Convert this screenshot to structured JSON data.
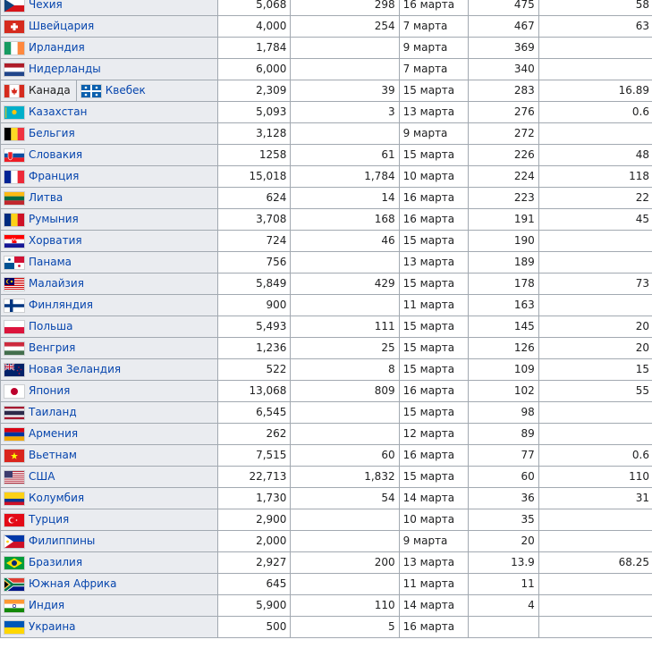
{
  "rows": [
    {
      "country": "Чехия",
      "flag": "flag-czech",
      "a": "5,068",
      "b": "298",
      "date": "16 марта",
      "d": "475",
      "e": "58"
    },
    {
      "country": "Швейцария",
      "flag": "flag-switzerland",
      "a": "4,000",
      "b": "254",
      "date": "7 марта",
      "d": "467",
      "e": "63"
    },
    {
      "country": "Ирландия",
      "flag": "flag-ireland",
      "a": "1,784",
      "b": "",
      "date": "9 марта",
      "d": "369",
      "e": ""
    },
    {
      "country": "Нидерланды",
      "flag": "flag-netherlands",
      "a": "6,000",
      "b": "",
      "date": "7 марта",
      "d": "340",
      "e": ""
    },
    {
      "country": "Канада",
      "flag": "flag-canada",
      "sub": "Квебек",
      "subflag": "flag-quebec",
      "a": "2,309",
      "b": "39",
      "date": "15 марта",
      "d": "283",
      "e": "16.89"
    },
    {
      "country": "Казахстан",
      "flag": "flag-kazakhstan",
      "a": "5,093",
      "b": "3",
      "date": "13 марта",
      "d": "276",
      "e": "0.6"
    },
    {
      "country": "Бельгия",
      "flag": "flag-belgium",
      "a": "3,128",
      "b": "",
      "date": "9 марта",
      "d": "272",
      "e": ""
    },
    {
      "country": "Словакия",
      "flag": "flag-slovakia",
      "a": "1258",
      "b": "61",
      "date": "15 марта",
      "d": "226",
      "e": "48"
    },
    {
      "country": "Франция",
      "flag": "flag-france",
      "a": "15,018",
      "b": "1,784",
      "date": "10 марта",
      "d": "224",
      "e": "118"
    },
    {
      "country": "Литва",
      "flag": "flag-lithuania",
      "a": "624",
      "b": "14",
      "date": "16 марта",
      "d": "223",
      "e": "22"
    },
    {
      "country": "Румыния",
      "flag": "flag-romania",
      "a": "3,708",
      "b": "168",
      "date": "16 марта",
      "d": "191",
      "e": "45"
    },
    {
      "country": "Хорватия",
      "flag": "flag-croatia",
      "a": "724",
      "b": "46",
      "date": "15 марта",
      "d": "190",
      "e": ""
    },
    {
      "country": "Панама",
      "flag": "flag-panama",
      "a": "756",
      "b": "",
      "date": "13 марта",
      "d": "189",
      "e": ""
    },
    {
      "country": "Малайзия",
      "flag": "flag-malaysia",
      "a": "5,849",
      "b": "429",
      "date": "15 марта",
      "d": "178",
      "e": "73"
    },
    {
      "country": "Финляндия",
      "flag": "flag-finland",
      "a": "900",
      "b": "",
      "date": "11 марта",
      "d": "163",
      "e": ""
    },
    {
      "country": "Польша",
      "flag": "flag-poland",
      "a": "5,493",
      "b": "111",
      "date": "15 марта",
      "d": "145",
      "e": "20"
    },
    {
      "country": "Венгрия",
      "flag": "flag-hungary",
      "a": "1,236",
      "b": "25",
      "date": "15 марта",
      "d": "126",
      "e": "20"
    },
    {
      "country": "Новая Зеландия",
      "flag": "flag-new-zealand",
      "a": "522",
      "b": "8",
      "date": "15 марта",
      "d": "109",
      "e": "15"
    },
    {
      "country": "Япония",
      "flag": "flag-japan",
      "a": "13,068",
      "b": "809",
      "date": "16 марта",
      "d": "102",
      "e": "55"
    },
    {
      "country": "Таиланд",
      "flag": "flag-thailand",
      "a": "6,545",
      "b": "",
      "date": "15 марта",
      "d": "98",
      "e": ""
    },
    {
      "country": "Армения",
      "flag": "flag-armenia",
      "a": "262",
      "b": "",
      "date": "12 марта",
      "d": "89",
      "e": ""
    },
    {
      "country": "Вьетнам",
      "flag": "flag-vietnam",
      "a": "7,515",
      "b": "60",
      "date": "16 марта",
      "d": "77",
      "e": "0.6"
    },
    {
      "country": "США",
      "flag": "flag-usa",
      "a": "22,713",
      "b": "1,832",
      "date": "15 марта",
      "d": "60",
      "e": "110"
    },
    {
      "country": "Колумбия",
      "flag": "flag-colombia",
      "a": "1,730",
      "b": "54",
      "date": "14 марта",
      "d": "36",
      "e": "31"
    },
    {
      "country": "Турция",
      "flag": "flag-turkey",
      "a": "2,900",
      "b": "",
      "date": "10 марта",
      "d": "35",
      "e": ""
    },
    {
      "country": "Филиппины",
      "flag": "flag-philippines",
      "a": "2,000",
      "b": "",
      "date": "9 марта",
      "d": "20",
      "e": ""
    },
    {
      "country": "Бразилия",
      "flag": "flag-brazil",
      "a": "2,927",
      "b": "200",
      "date": "13 марта",
      "d": "13.9",
      "e": "68.25"
    },
    {
      "country": "Южная Африка",
      "flag": "flag-south-africa",
      "a": "645",
      "b": "",
      "date": "11 марта",
      "d": "11",
      "e": ""
    },
    {
      "country": "Индия",
      "flag": "flag-india",
      "a": "5,900",
      "b": "110",
      "date": "14 марта",
      "d": "4",
      "e": ""
    },
    {
      "country": "Украина",
      "flag": "flag-ukraine",
      "a": "500",
      "b": "5",
      "date": "16 марта",
      "d": "",
      "e": ""
    }
  ],
  "colors": {
    "link": "#0645ad",
    "header_bg": "#eaecf0",
    "border": "#a2a9b1"
  }
}
